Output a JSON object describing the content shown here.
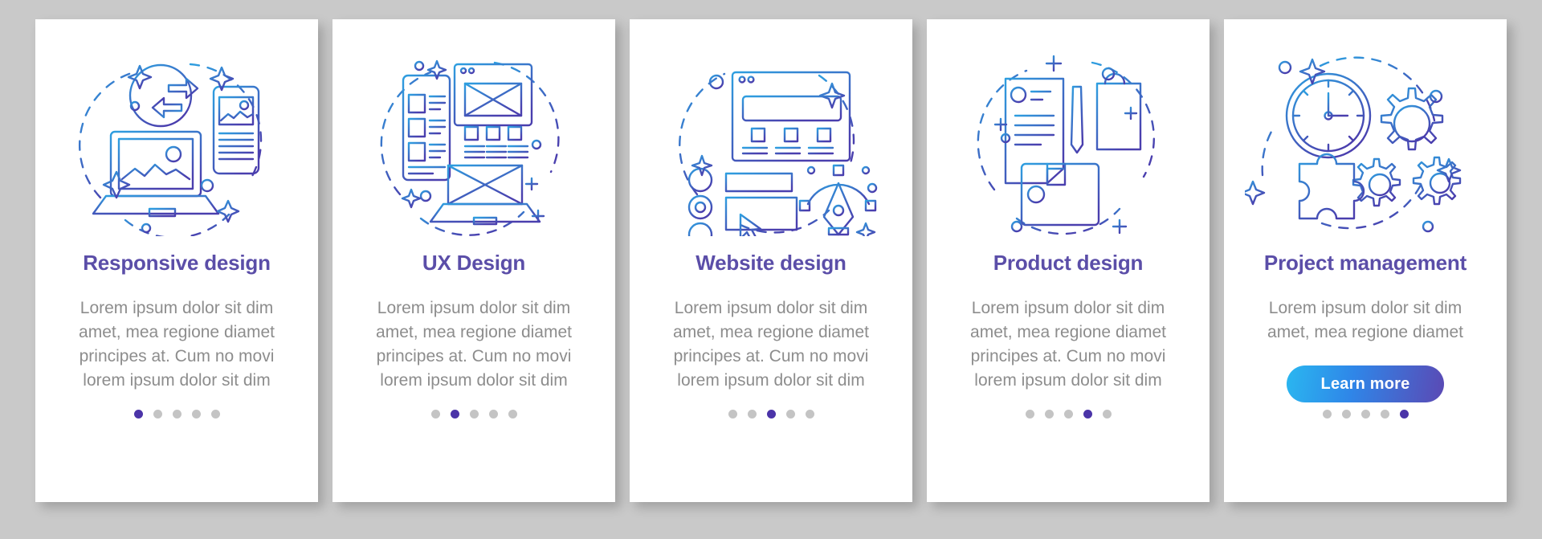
{
  "page": {
    "background_color": "#c9c9c9",
    "card_background": "#ffffff",
    "title_color": "#5b4ea8",
    "body_color": "#8d8d8d",
    "dot_active_color": "#4b34a8",
    "dot_inactive_color": "#c4c4c4",
    "illustration_gradient_from": "#2e9fe0",
    "illustration_gradient_to": "#4a3fae",
    "cta_gradient_from": "#2ab7f0",
    "cta_gradient_to": "#5b49b4"
  },
  "cards": [
    {
      "title": "Responsive design",
      "body": "Lorem ipsum dolor sit dim amet, mea regione diamet principes at. Cum no movi lorem ipsum dolor sit dim",
      "illustration": "responsive-design-illustration",
      "dots": {
        "count": 5,
        "active_index": 0
      },
      "cta": null
    },
    {
      "title": "UX Design",
      "body": "Lorem ipsum dolor sit dim amet, mea regione diamet principes at. Cum no movi lorem ipsum dolor sit dim",
      "illustration": "ux-design-illustration",
      "dots": {
        "count": 5,
        "active_index": 1
      },
      "cta": null
    },
    {
      "title": "Website design",
      "body": "Lorem ipsum dolor sit dim amet, mea regione diamet principes at. Cum no movi lorem ipsum dolor sit dim",
      "illustration": "website-design-illustration",
      "dots": {
        "count": 5,
        "active_index": 2
      },
      "cta": null
    },
    {
      "title": "Product design",
      "body": "Lorem ipsum dolor sit dim amet, mea regione diamet principes at. Cum no movi lorem ipsum dolor sit dim",
      "illustration": "product-design-illustration",
      "dots": {
        "count": 5,
        "active_index": 3
      },
      "cta": null
    },
    {
      "title": "Project management",
      "body": "Lorem ipsum dolor sit dim amet, mea regione diamet",
      "illustration": "project-management-illustration",
      "dots": {
        "count": 5,
        "active_index": 4
      },
      "cta": {
        "label": "Learn more"
      }
    }
  ]
}
